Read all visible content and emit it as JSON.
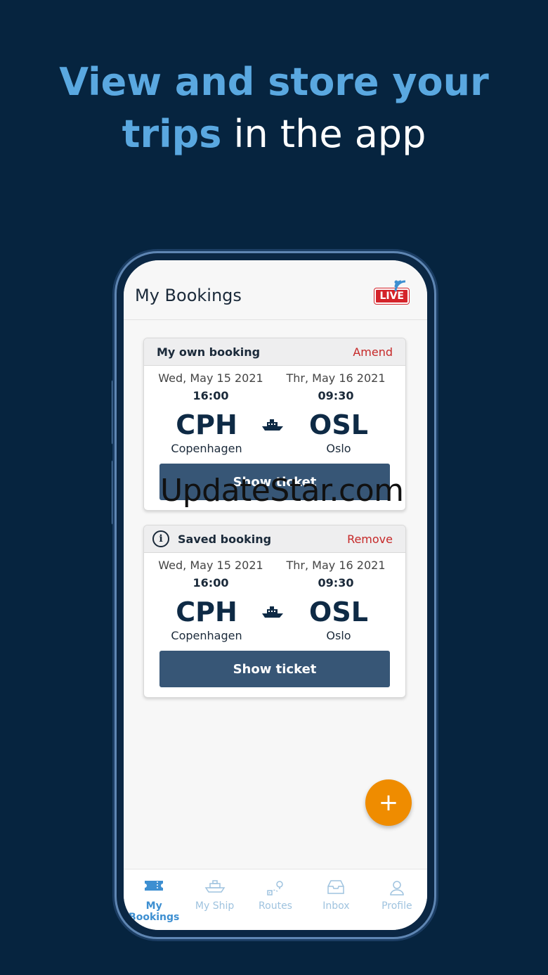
{
  "headline": {
    "line1": "View and store your",
    "line2_highlight": "trips",
    "line2_rest": " in the app"
  },
  "screen": {
    "title": "My Bookings",
    "live_badge": "LIVE"
  },
  "bookings": [
    {
      "header_label": "My own booking",
      "action": "Amend",
      "has_info_icon": false,
      "depart_date": "Wed, May 15 2021",
      "depart_time": "16:00",
      "arrive_date": "Thr, May 16 2021",
      "arrive_time": "09:30",
      "from_code": "CPH",
      "from_city": "Copenhagen",
      "to_code": "OSL",
      "to_city": "Oslo",
      "button": "Show ticket"
    },
    {
      "header_label": "Saved booking",
      "action": "Remove",
      "has_info_icon": true,
      "depart_date": "Wed, May 15 2021",
      "depart_time": "16:00",
      "arrive_date": "Thr, May 16 2021",
      "arrive_time": "09:30",
      "from_code": "CPH",
      "from_city": "Copenhagen",
      "to_code": "OSL",
      "to_city": "Oslo",
      "button": "Show ticket"
    }
  ],
  "watermark": "UpdateStar.com",
  "fab_icon": "+",
  "tabs": [
    {
      "label": "My Bookings",
      "icon": "ticket-icon",
      "active": true
    },
    {
      "label": "My Ship",
      "icon": "ship-icon",
      "active": false
    },
    {
      "label": "Routes",
      "icon": "route-icon",
      "active": false
    },
    {
      "label": "Inbox",
      "icon": "inbox-icon",
      "active": false
    },
    {
      "label": "Profile",
      "icon": "profile-icon",
      "active": false
    }
  ],
  "colors": {
    "background": "#06243f",
    "highlight": "#5aa8e0",
    "button": "#375676",
    "action_red": "#c62828",
    "fab": "#ef8c00",
    "tab_active": "#3d8fd1"
  }
}
